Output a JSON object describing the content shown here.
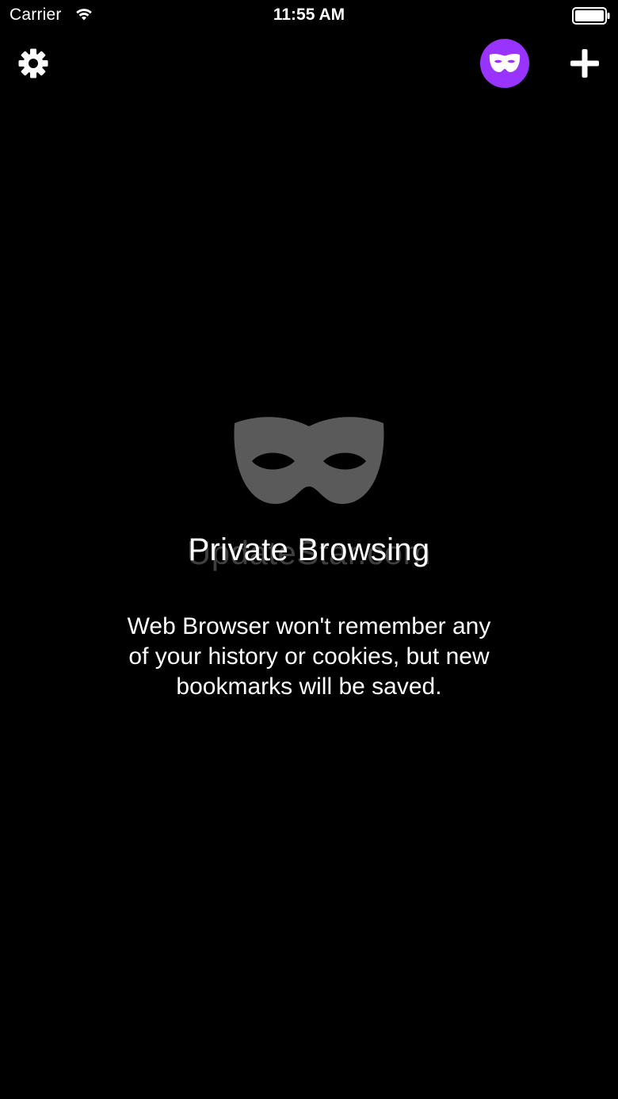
{
  "status_bar": {
    "carrier": "Carrier",
    "time": "11:55 AM",
    "icons": [
      "wifi-icon",
      "battery-icon"
    ]
  },
  "toolbar": {
    "settings_icon": "gear-icon",
    "private_toggle_icon": "mask-icon",
    "add_icon": "plus-icon",
    "accent_color": "#9933ff"
  },
  "empty_state": {
    "icon": "mask-icon",
    "icon_color": "#5a5a5a",
    "title": "Private Browsing",
    "description": "Web Browser won't remember any of your history or cookies, but new bookmarks will be saved.",
    "watermark": "UpdateStar.com"
  },
  "colors": {
    "background": "#000000",
    "text": "#ffffff"
  }
}
